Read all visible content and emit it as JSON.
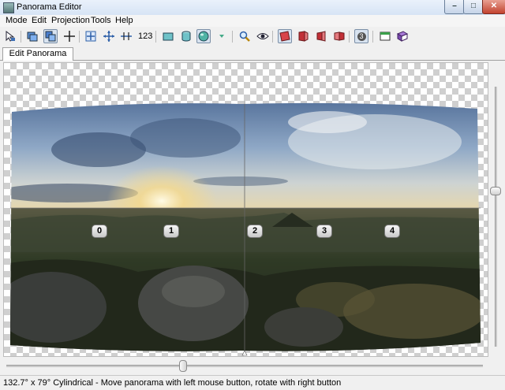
{
  "window": {
    "title": "Panorama Editor"
  },
  "window_controls": {
    "minimize": "–",
    "maximize": "□",
    "close": "✕"
  },
  "menu": [
    "Mode",
    "Edit",
    "Projection",
    "Tools",
    "Help"
  ],
  "toolbar": {
    "number_label": "123",
    "image_count": "3"
  },
  "tabs": [
    {
      "label": "Edit Panorama",
      "active": true
    }
  ],
  "panorama": {
    "image_labels": [
      "0",
      "1",
      "2",
      "3",
      "4"
    ],
    "projection": "Cylindrical",
    "sky_color": "#8fa8c6",
    "ground_color": "#2a2e22"
  },
  "status": {
    "text": "132.7° x 79° Cylindrical - Move panorama with left mouse button, rotate with right button"
  },
  "colors": {
    "accent": "#3d6fb4",
    "checker": "#cfcfcf",
    "titlebar": "#d7e4f5"
  }
}
